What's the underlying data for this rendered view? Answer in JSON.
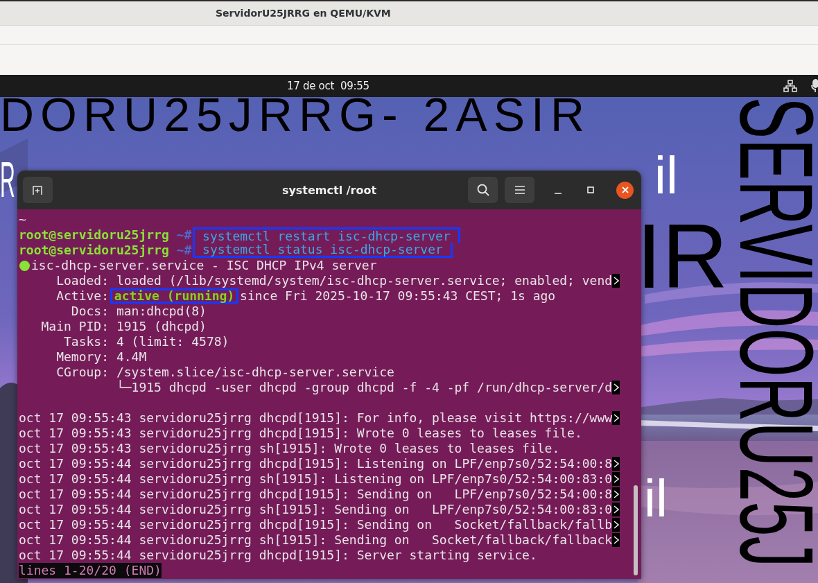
{
  "vm_window": {
    "title": "ServidorU25JRRG en QEMU/KVM"
  },
  "top_bar": {
    "clock": "17 de oct  09:55"
  },
  "wallpaper": {
    "kind": "picture",
    "texts": [
      {
        "text": "DORU25JRRG- 2ASIR",
        "light": false,
        "vertical": false
      },
      {
        "text": "R",
        "light": true,
        "vertical": false
      },
      {
        "text": "il",
        "light": true,
        "vertical": false
      },
      {
        "text": "IR",
        "light": false,
        "vertical": false
      },
      {
        "text": "il",
        "light": true,
        "vertical": false
      },
      {
        "text": "SERVIDORU25J",
        "light": false,
        "vertical": true
      }
    ]
  },
  "terminal": {
    "title": "systemctl /root",
    "lines": [
      {
        "kind": "text",
        "text": "~"
      },
      {
        "kind": "prompt",
        "user": "root@servidoru25jrrg",
        "symbol": "~#",
        "command": "systemctl restart isc-dhcp-server",
        "boxed": true
      },
      {
        "kind": "prompt",
        "user": "root@servidoru25jrrg",
        "symbol": "~#",
        "command": "systemctl status isc-dhcp-server",
        "boxed": true
      },
      {
        "kind": "unit",
        "active": true,
        "text": "isc-dhcp-server.service - ISC DHCP IPv4 server"
      },
      {
        "kind": "field",
        "label": "Loaded:",
        "value": "loaded (/lib/systemd/system/isc-dhcp-server.service; enabled; vend",
        "truncated": true
      },
      {
        "kind": "field",
        "label": "Active:",
        "state": "active (running)",
        "boxed": true,
        "value": "since Fri 2025-10-17 09:55:43 CEST; 1s ago",
        "truncated": false
      },
      {
        "kind": "field",
        "label": "Docs:",
        "value": "man:dhcpd(8)",
        "truncated": false
      },
      {
        "kind": "field",
        "label": "Main PID:",
        "value": "1915 (dhcpd)",
        "truncated": false
      },
      {
        "kind": "field",
        "label": "Tasks:",
        "value": "4 (limit: 4578)",
        "truncated": false
      },
      {
        "kind": "field",
        "label": "Memory:",
        "value": "4.4M",
        "truncated": false
      },
      {
        "kind": "field",
        "label": "CGroup:",
        "value": "/system.slice/isc-dhcp-server.service",
        "truncated": false
      },
      {
        "kind": "tree",
        "text": "└─1915 dhcpd -user dhcpd -group dhcpd -f -4 -pf /run/dhcp-server/d",
        "truncated": true
      },
      {
        "kind": "blank"
      },
      {
        "kind": "log",
        "text": "oct 17 09:55:43 servidoru25jrrg dhcpd[1915]: For info, please visit https://www",
        "truncated": true
      },
      {
        "kind": "log",
        "text": "oct 17 09:55:43 servidoru25jrrg dhcpd[1915]: Wrote 0 leases to leases file.",
        "truncated": false
      },
      {
        "kind": "log",
        "text": "oct 17 09:55:43 servidoru25jrrg sh[1915]: Wrote 0 leases to leases file.",
        "truncated": false
      },
      {
        "kind": "log",
        "text": "oct 17 09:55:44 servidoru25jrrg dhcpd[1915]: Listening on LPF/enp7s0/52:54:00:8",
        "truncated": true
      },
      {
        "kind": "log",
        "text": "oct 17 09:55:44 servidoru25jrrg sh[1915]: Listening on LPF/enp7s0/52:54:00:83:0",
        "truncated": true
      },
      {
        "kind": "log",
        "text": "oct 17 09:55:44 servidoru25jrrg dhcpd[1915]: Sending on   LPF/enp7s0/52:54:00:8",
        "truncated": true
      },
      {
        "kind": "log",
        "text": "oct 17 09:55:44 servidoru25jrrg sh[1915]: Sending on   LPF/enp7s0/52:54:00:83:0",
        "truncated": true
      },
      {
        "kind": "log",
        "text": "oct 17 09:55:44 servidoru25jrrg dhcpd[1915]: Sending on   Socket/fallback/fallb",
        "truncated": true
      },
      {
        "kind": "log",
        "text": "oct 17 09:55:44 servidoru25jrrg sh[1915]: Sending on   Socket/fallback/fallback",
        "truncated": true
      },
      {
        "kind": "log",
        "text": "oct 17 09:55:44 servidoru25jrrg dhcpd[1915]: Server starting service.",
        "truncated": false
      },
      {
        "kind": "pager",
        "text": "lines 1-20/20 (END)"
      }
    ]
  }
}
